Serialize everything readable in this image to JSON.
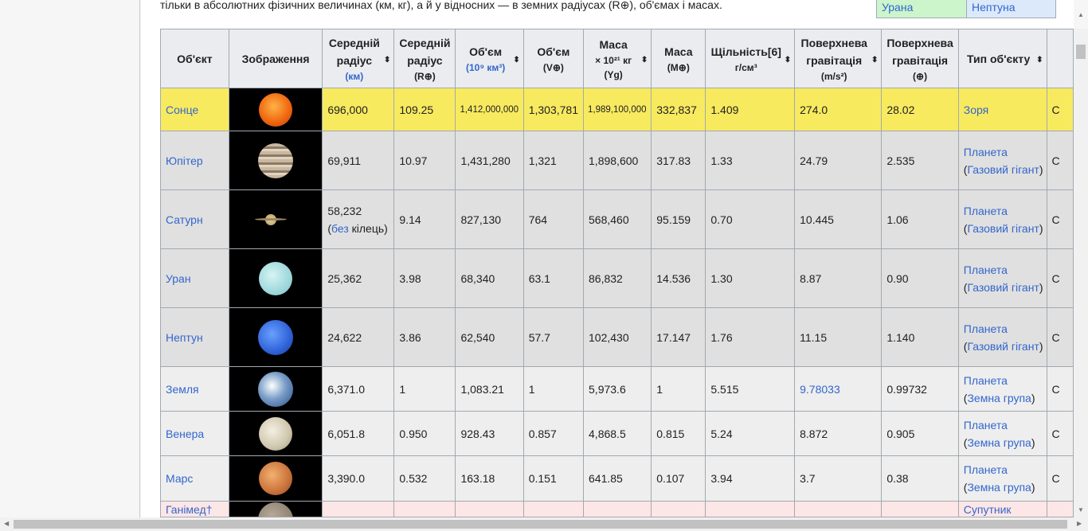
{
  "intro": "тільки в абсолютних фізичних величинах (км, кг), а й у відносних — в земних радіусах (R⊕), об'ємах і масах.",
  "navbox": [
    "Урана",
    "Нептуна"
  ],
  "headers": [
    {
      "main": "Об'єкт",
      "sub": "",
      "sort": false
    },
    {
      "main": "Зображення",
      "sub": "",
      "sort": false
    },
    {
      "main": "Середній радіус",
      "sub": "(км)",
      "sort": true
    },
    {
      "main": "Середній радіус",
      "sub": "(R⊕)",
      "sort": false
    },
    {
      "main": "Об'єм",
      "sub": "(10⁹ км³)",
      "sort": true
    },
    {
      "main": "Об'єм",
      "sub": "(V⊕)",
      "sort": false
    },
    {
      "main": "Маса",
      "sub": "× 10²¹ кг (Yg)",
      "sort": true
    },
    {
      "main": "Маса",
      "sub": "(M⊕)",
      "sort": false
    },
    {
      "main": "Щільність[6]",
      "sub": "г/см³",
      "sort": true
    },
    {
      "main": "Поверхнева гравітація",
      "sub": "(m/s²)",
      "sort": true
    },
    {
      "main": "Поверхнева гравітація",
      "sub": "(⊕)",
      "sort": false
    },
    {
      "main": "Тип об'єкту",
      "sub": "",
      "sort": true
    }
  ],
  "rows": [
    {
      "name": "Сонце",
      "cells": [
        "696,000",
        "109.25",
        "1,412,000,000",
        "1,303,781",
        "1,989,100,000",
        "332,837",
        "1.409",
        "274.0",
        "28.02"
      ],
      "type": "Зоря",
      "subtype": "",
      "next": "С",
      "bg": "#f8ea5f",
      "img": "sun"
    },
    {
      "name": "Юпітер",
      "cells": [
        "69,911",
        "10.97",
        "1,431,280",
        "1,321",
        "1,898,600",
        "317.83",
        "1.33",
        "24.79",
        "2.535"
      ],
      "type": "Планета",
      "subtype": "Газовий гігант",
      "next": "С",
      "bg": "#e0e0e0",
      "img": "jupiter"
    },
    {
      "name": "Сатурн",
      "cells": [
        "58,232 (без кілець)",
        "9.14",
        "827,130",
        "764",
        "568,460",
        "95.159",
        "0.70",
        "10.445",
        "1.06"
      ],
      "type": "Планета",
      "subtype": "Газовий гігант",
      "next": "С",
      "bg": "#e0e0e0",
      "img": "saturn"
    },
    {
      "name": "Уран",
      "cells": [
        "25,362",
        "3.98",
        "68,340",
        "63.1",
        "86,832",
        "14.536",
        "1.30",
        "8.87",
        "0.90"
      ],
      "type": "Планета",
      "subtype": "Газовий гігант",
      "next": "С",
      "bg": "#e0e0e0",
      "img": "uranus"
    },
    {
      "name": "Нептун",
      "cells": [
        "24,622",
        "3.86",
        "62,540",
        "57.7",
        "102,430",
        "17.147",
        "1.76",
        "11.15",
        "1.140"
      ],
      "type": "Планета",
      "subtype": "Газовий гігант",
      "next": "С",
      "bg": "#e0e0e0",
      "img": "neptune"
    },
    {
      "name": "Земля",
      "cells": [
        "6,371.0",
        "1",
        "1,083.21",
        "1",
        "5,973.6",
        "1",
        "5.515",
        "9.78033",
        "0.99732"
      ],
      "type": "Планета",
      "subtype": "Земна група",
      "next": "С",
      "bg": "#eeeeee",
      "img": "earth"
    },
    {
      "name": "Венера",
      "cells": [
        "6,051.8",
        "0.950",
        "928.43",
        "0.857",
        "4,868.5",
        "0.815",
        "5.24",
        "8.872",
        "0.905"
      ],
      "type": "Планета",
      "subtype": "Земна група",
      "next": "С",
      "bg": "#eeeeee",
      "img": "venus"
    },
    {
      "name": "Марс",
      "cells": [
        "3,390.0",
        "0.532",
        "163.18",
        "0.151",
        "641.85",
        "0.107",
        "3.94",
        "3.7",
        "0.38"
      ],
      "type": "Планета",
      "subtype": "Земна група",
      "next": "С",
      "bg": "#eeeeee",
      "img": "mars"
    },
    {
      "name": "Ганімед†",
      "cells": [
        "",
        "",
        "",
        "",
        "",
        "",
        "",
        "",
        ""
      ],
      "type": "Супутник",
      "subtype": "",
      "next": "",
      "bg": "#fde6e6",
      "img": "ganymede"
    }
  ]
}
